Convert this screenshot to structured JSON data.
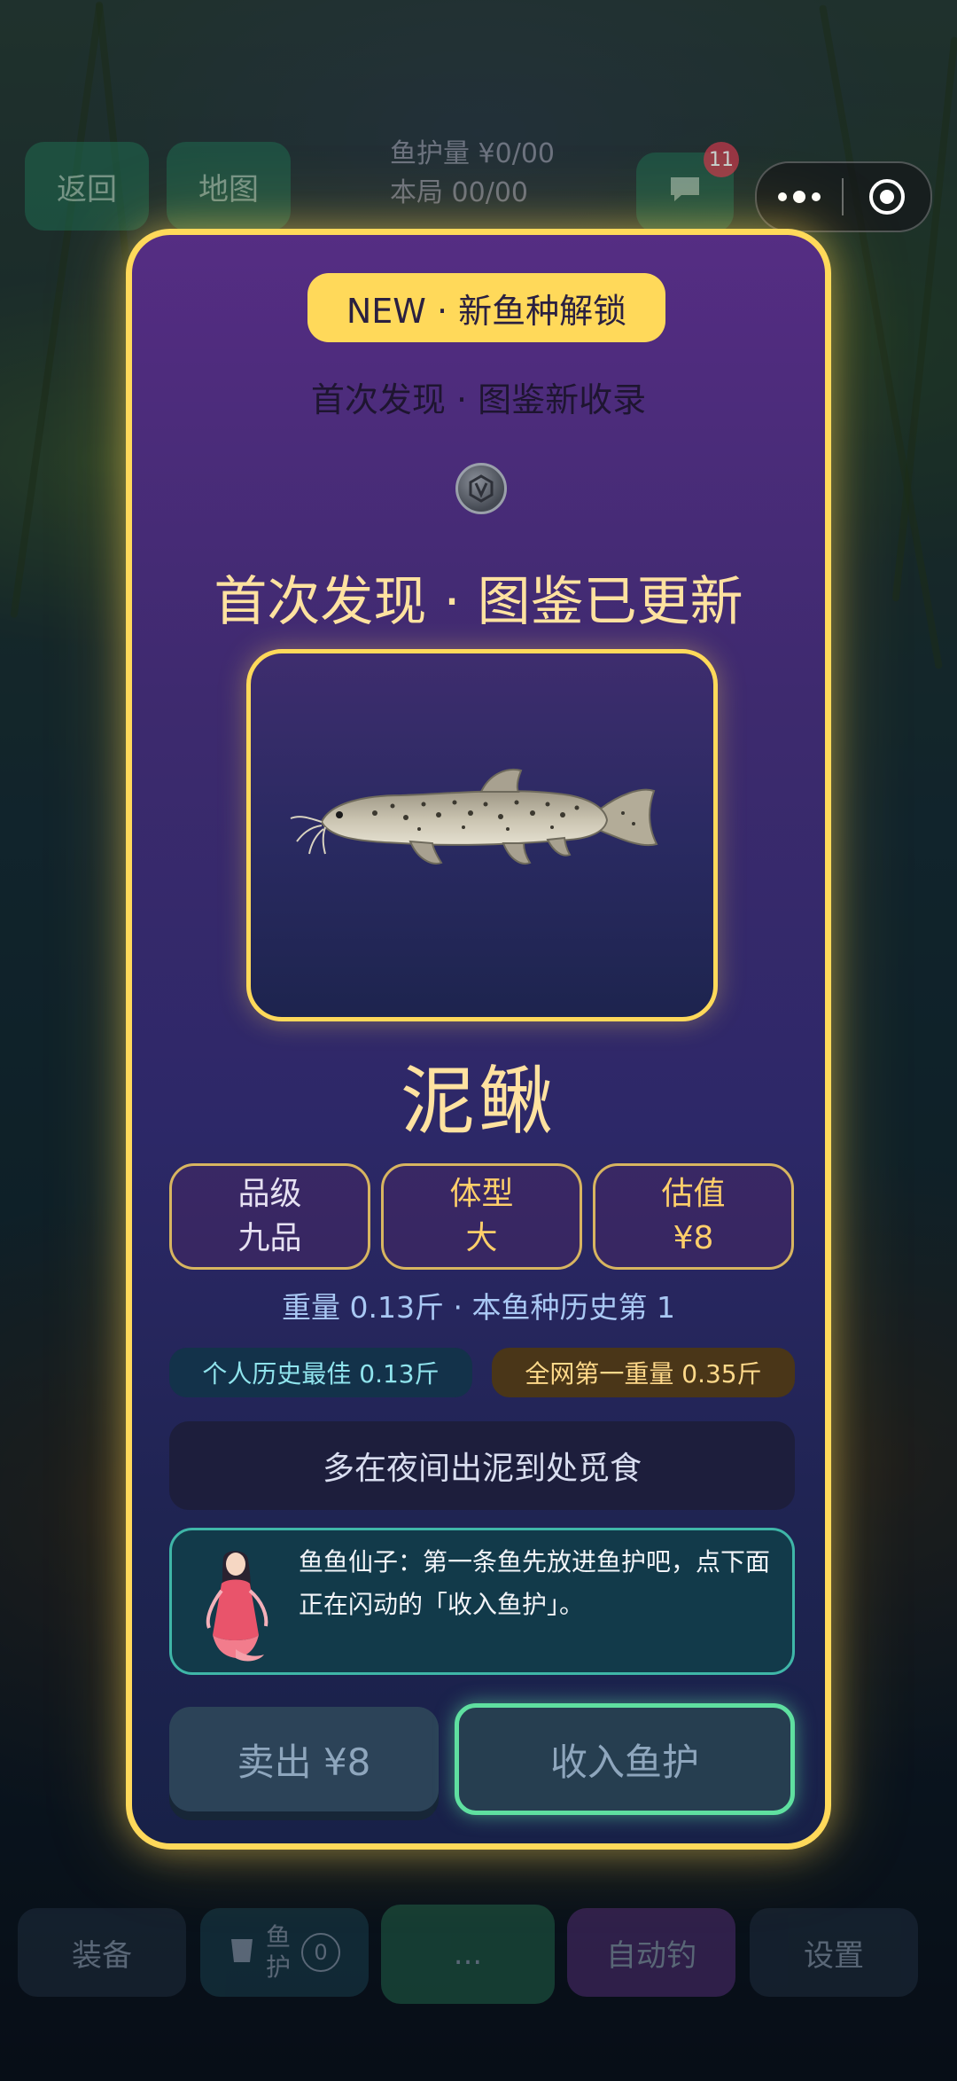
{
  "hud": {
    "back_label": "返回",
    "map_label": "地图",
    "line1": "鱼护量 ¥0/00",
    "line2": "本局 00/00",
    "notif_count": "11"
  },
  "bottom_bar": {
    "equip_label": "装备",
    "creel_label_1": "鱼",
    "creel_label_2": "护",
    "creel_count": "0",
    "cast_label": "...",
    "auto_label": "自动钓",
    "settings_label": "设置"
  },
  "modal": {
    "new_badge": "NEW · 新鱼种解锁",
    "subtitle": "首次发现 · 图鉴新收录",
    "headline": "首次发现 · 图鉴已更新",
    "fish_name": "泥鳅",
    "stats": [
      {
        "label": "品级",
        "value": "九品",
        "color": "#e6e1f2"
      },
      {
        "label": "体型",
        "value": "大",
        "color": "#ffcf6a"
      },
      {
        "label": "估值",
        "value": "¥8",
        "color": "#ffcf6a"
      }
    ],
    "weight_line": "重量 0.13斤  ·  本鱼种历史第 1",
    "personal_best": "个人历史最佳  0.13斤",
    "global_best": "全网第一重量  0.35斤",
    "tip": "多在夜间出泥到处觅食",
    "fairy_text": "鱼鱼仙子：第一条鱼先放进鱼护吧，点下面正在闪动的「收入鱼护」。",
    "sell_label": "卖出 ¥8",
    "keep_label": "收入鱼护"
  },
  "colors": {
    "modal_border": "#ffd95a",
    "accent_green": "#5fe0a0",
    "title_gold": "#ffe2a0"
  }
}
